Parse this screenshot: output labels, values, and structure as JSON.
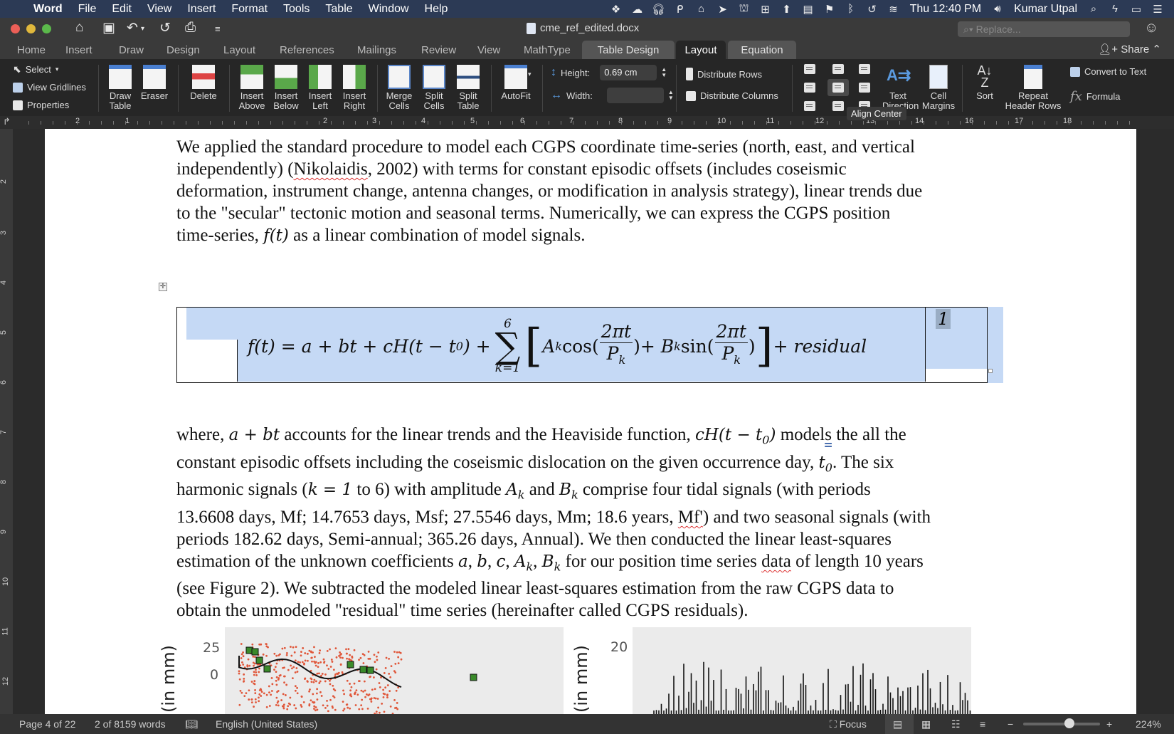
{
  "mac_menubar": {
    "app_name": "Word",
    "menus": [
      "File",
      "Edit",
      "View",
      "Insert",
      "Format",
      "Tools",
      "Table",
      "Window",
      "Help"
    ],
    "clock": "Thu 12:40 PM",
    "user": "Kumar Utpal",
    "status_icons": [
      "dropbox-icon",
      "cloud-icon",
      "headphones-icon",
      "evernote-icon",
      "app-icon",
      "arrow-icon",
      "building-icon",
      "grid-icon",
      "upload-icon",
      "notes-icon",
      "flag-icon",
      "bluetooth-icon",
      "time-machine-icon",
      "wifi-icon",
      "volume-icon"
    ]
  },
  "window": {
    "document_title": "cme_ref_edited.docx",
    "search_placeholder": "Replace...",
    "quick_access": [
      "home-icon",
      "save-icon",
      "undo-icon",
      "redo-icon",
      "print-icon",
      "customize-icon"
    ]
  },
  "tabs": {
    "items": [
      "Home",
      "Insert",
      "Draw",
      "Design",
      "Layout",
      "References",
      "Mailings",
      "Review",
      "View",
      "MathType"
    ],
    "contextual": [
      "Table Design",
      "Layout",
      "Equation"
    ],
    "active": "Layout",
    "share_label": "Share"
  },
  "ribbon": {
    "select_label": "Select",
    "view_gridlines_label": "View Gridlines",
    "properties_label": "Properties",
    "draw_table_label": "Draw\nTable",
    "eraser_label": "Eraser",
    "delete_label": "Delete",
    "insert_above_label": "Insert\nAbove",
    "insert_below_label": "Insert\nBelow",
    "insert_left_label": "Insert\nLeft",
    "insert_right_label": "Insert\nRight",
    "merge_cells_label": "Merge\nCells",
    "split_cells_label": "Split\nCells",
    "split_table_label": "Split\nTable",
    "autofit_label": "AutoFit",
    "height_label": "Height:",
    "height_value": "0.69 cm",
    "width_label": "Width:",
    "width_value": "",
    "distribute_rows_label": "Distribute Rows",
    "distribute_columns_label": "Distribute Columns",
    "text_direction_label": "Text\nDirection",
    "cell_margins_label": "Cell\nMargins",
    "sort_label": "Sort",
    "repeat_header_rows_label": "Repeat\nHeader Rows",
    "convert_to_text_label": "Convert to Text",
    "formula_label": "Formula",
    "tooltip": "Align Center"
  },
  "rulers": {
    "horizontal": [
      "2",
      "1",
      "2",
      "3",
      "4",
      "5",
      "6",
      "7",
      "8",
      "9",
      "10",
      "11",
      "12",
      "13",
      "14",
      "16",
      "17",
      "18"
    ],
    "vertical": [
      "2",
      "3",
      "4",
      "5",
      "6",
      "7",
      "8",
      "9",
      "10",
      "11",
      "12"
    ]
  },
  "document": {
    "para1_lines": [
      "We applied the standard procedure to model each CGPS coordinate time-series (north, east, and vertical",
      "independently) (Nikolaidis, 2002) with terms for constant episodic offsets (includes coseismic",
      "deformation, instrument change, antenna changes, or modification in analysis strategy), linear trends due",
      "to the \"secular\" tectonic motion and seasonal terms. Numerically, we can express the CGPS position",
      "time-series, f(t) as a linear combination of model signals."
    ],
    "equation": {
      "lhs": "f(t) = a + bt + cH(t − t",
      "sub0": "0",
      "after_h": ") + ",
      "sum_upper": "6",
      "sum_lower": "k=1",
      "a_k": "A",
      "k": "k",
      "cos": "cos(",
      "num": "2πt",
      "den": "P",
      "close": ")",
      "plus_b": " + B",
      "sin": "sin(",
      "tail": " + residual",
      "number": "1"
    },
    "para2_lines": [
      "where, a + bt accounts for the linear trends and the Heaviside function, cH(t − t0) models the all the",
      "constant episodic offsets including the coseismic dislocation on the given occurrence day, t0. The six",
      "harmonic signals (k = 1 to 6) with amplitude Ak and Bk comprise four tidal signals (with periods",
      "13.6608 days, Mf; 14.7653 days, Msf; 27.5546 days, Mm; 18.6 years, Mf') and two seasonal signals (with",
      "periods 182.62 days, Semi-annual; 365.26 days, Annual). We then conducted the linear least-squares",
      "estimation of the unknown coefficients a, b, c, Ak, Bk for our position time series data of length 10 years",
      "(see Figure 2). We subtracted the modeled linear least-squares estimation from the raw CGPS data to",
      "obtain the unmodeled \"residual\" time series (hereinafter called CGPS residuals)."
    ],
    "figure": {
      "left_ylabel": "(in mm)",
      "left_ticks": [
        "25",
        "0"
      ],
      "right_ylabel": "(in mm)",
      "right_ticks": [
        "20"
      ]
    }
  },
  "statusbar": {
    "page": "Page 4 of 22",
    "words": "2 of 8159 words",
    "language": "English (United States)",
    "focus_label": "Focus",
    "zoom": "224%",
    "zoom_fraction": 0.6
  }
}
